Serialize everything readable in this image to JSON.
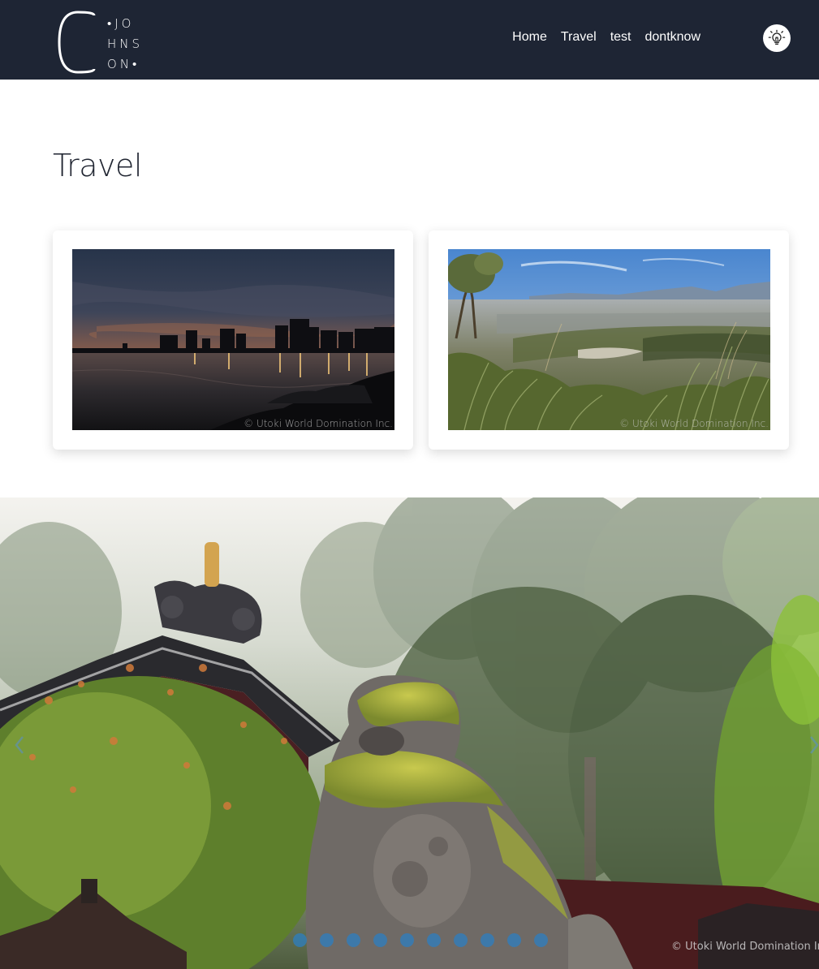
{
  "header": {
    "logo": {
      "initial": "C",
      "lines": [
        "•JO",
        "HNS",
        "ON•"
      ]
    },
    "nav": [
      {
        "label": "Home"
      },
      {
        "label": "Travel"
      },
      {
        "label": "test"
      },
      {
        "label": "dontknow"
      }
    ],
    "theme_toggle_icon": "lightbulb-icon"
  },
  "main": {
    "title": "Travel",
    "cards": [
      {
        "image": "city-skyline-sunset",
        "copyright": "© Utoki World Domination Inc."
      },
      {
        "image": "grassland-valley-view",
        "copyright": "© Utoki World Domination Inc."
      }
    ]
  },
  "carousel": {
    "image": "mossy-stone-lion-shrine",
    "copyright": "© Utoki World Domination Inc.",
    "dot_count": 10,
    "prev_icon": "chevron-left-icon",
    "next_icon": "chevron-right-icon"
  },
  "colors": {
    "header_bg": "#1e2534",
    "accent": "#2c7fc1",
    "title_text": "#1f2430"
  }
}
